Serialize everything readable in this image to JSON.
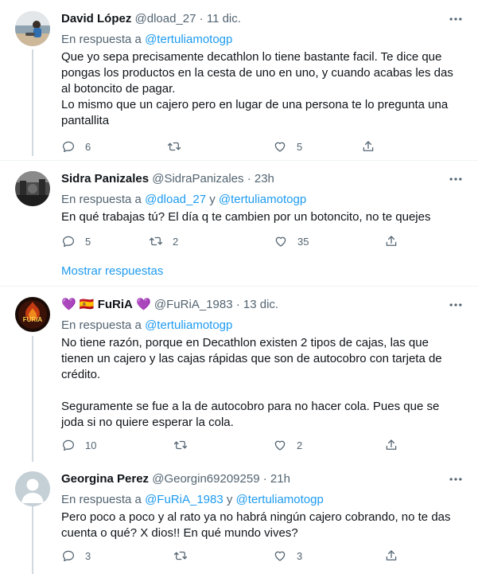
{
  "tweets": [
    {
      "name": "David López",
      "handle": "@dload_27",
      "separator": "·",
      "time": "11 dic.",
      "reply_prefix": "En respuesta a",
      "reply_to_1": "@tertuliamotogp",
      "text": "Que yo sepa precisamente decathlon lo tiene bastante facil. Te dice que pongas los productos en la cesta de uno en uno, y cuando acabas les das al botoncito de pagar.\nLo mismo que un cajero pero en lugar de una persona te lo pregunta una pantallita",
      "replies": "6",
      "retweets": "",
      "likes": "5"
    },
    {
      "name": "Sidra Panizales",
      "handle": "@SidraPanizales",
      "separator": "·",
      "time": "23h",
      "reply_prefix": "En respuesta a",
      "reply_to_1": "@dload_27",
      "reply_joiner": "y",
      "reply_to_2": "@tertuliamotogp",
      "text": "En qué trabajas tú? El día q te cambien por un botoncito, no te quejes",
      "replies": "5",
      "retweets": "2",
      "likes": "35"
    },
    {
      "name_prefix": "💜",
      "name_flag": "🇪🇸",
      "name": "FuRiA",
      "name_suffix": "💜",
      "handle": "@FuRiA_1983",
      "separator": "·",
      "time": "13 dic.",
      "reply_prefix": "En respuesta a",
      "reply_to_1": "@tertuliamotogp",
      "text": "No tiene razón, porque en Decathlon existen 2 tipos de cajas, las que tienen un cajero y las cajas rápidas que son de autocobro con tarjeta de crédito.\n\nSeguramente se fue a la de autocobro para no hacer cola. Pues que se joda si no quiere esperar la cola.",
      "replies": "10",
      "retweets": "",
      "likes": "2"
    },
    {
      "name": "Georgina Perez",
      "handle": "@Georgin69209259",
      "separator": "·",
      "time": "21h",
      "reply_prefix": "En respuesta a",
      "reply_to_1": "@FuRiA_1983",
      "reply_joiner": "y",
      "reply_to_2": "@tertuliamotogp",
      "text": "Pero poco a poco y al rato ya no habrá ningún cajero cobrando, no te das cuenta o qué? X dios!! En qué mundo vives?",
      "replies": "3",
      "retweets": "",
      "likes": "3"
    }
  ],
  "show_replies_label": "Mostrar respuestas",
  "avatar_logo_text": "FURIA",
  "icons": {
    "reply": "reply-icon",
    "retweet": "retweet-icon",
    "like": "heart-icon",
    "share": "share-icon",
    "more": "more-icon"
  },
  "colors": {
    "link": "#1d9bf0",
    "secondary_text": "#536471",
    "thread_line": "#cfd9de",
    "divider": "#eff3f4"
  }
}
